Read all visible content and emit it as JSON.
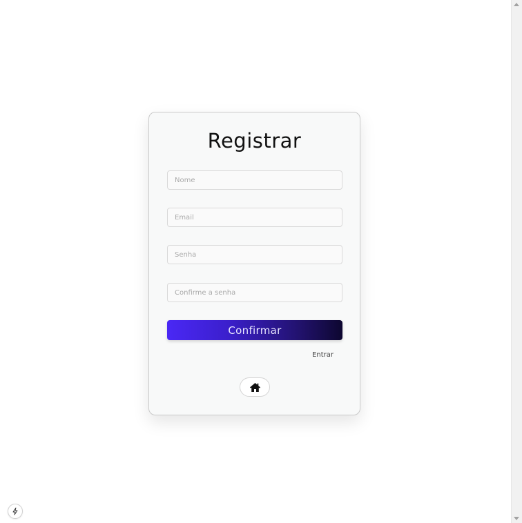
{
  "form": {
    "title": "Registrar",
    "fields": {
      "name": {
        "placeholder": "Nome",
        "value": ""
      },
      "email": {
        "placeholder": "Email",
        "value": ""
      },
      "password": {
        "placeholder": "Senha",
        "value": ""
      },
      "confirm_password": {
        "placeholder": "Confirme a senha",
        "value": ""
      }
    },
    "submit_label": "Confirmar",
    "login_link": "Entrar",
    "home_icon": "home-icon"
  },
  "overlay": {
    "dev_badge_icon": "bolt-icon"
  },
  "colors": {
    "button_gradient_start": "#4a28f5",
    "button_gradient_end": "#0d0730",
    "card_background": "#f8f9f9"
  }
}
